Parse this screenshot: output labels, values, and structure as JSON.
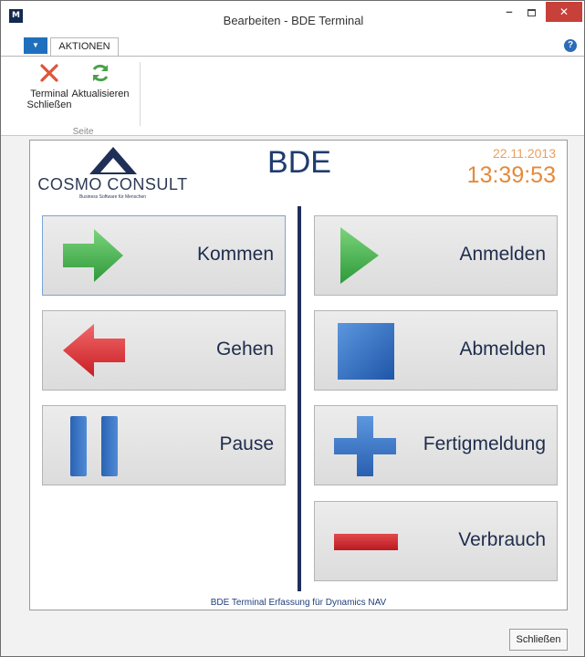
{
  "window": {
    "title": "Bearbeiten - BDE Terminal",
    "app_icon_text": "M",
    "minimize_glyph": "–",
    "close_glyph": "✕"
  },
  "ribbon": {
    "file_menu_glyph": "▼",
    "active_tab": "AKTIONEN",
    "help_glyph": "?",
    "buttons": [
      {
        "label_line1": "Terminal",
        "label_line2": "Schließen",
        "icon": "close-x-icon"
      },
      {
        "label_line1": "Aktualisieren",
        "label_line2": "",
        "icon": "refresh-icon"
      }
    ],
    "group_label": "Seite"
  },
  "terminal": {
    "logo_text": "COSMO CONSULT",
    "logo_tagline": "Business Software für Menschen",
    "heading": "BDE",
    "date": "22.11.2013",
    "time": "13:39:53",
    "left_actions": [
      {
        "label": "Kommen",
        "icon": "green-arrow-right-icon"
      },
      {
        "label": "Gehen",
        "icon": "red-arrow-left-icon"
      },
      {
        "label": "Pause",
        "icon": "pause-icon"
      }
    ],
    "right_actions": [
      {
        "label": "Anmelden",
        "icon": "green-play-icon"
      },
      {
        "label": "Abmelden",
        "icon": "blue-stop-icon"
      },
      {
        "label": "Fertigmeldung",
        "icon": "blue-plus-icon"
      },
      {
        "label": "Verbrauch",
        "icon": "red-minus-icon"
      }
    ],
    "caption": "BDE Terminal Erfassung für Dynamics NAV"
  },
  "footer": {
    "close_button": "Schließen"
  },
  "colors": {
    "accent_blue": "#1f6fbd",
    "title_navy": "#1e3c6e",
    "time_orange": "#e48a3a",
    "close_red": "#c7403a"
  }
}
